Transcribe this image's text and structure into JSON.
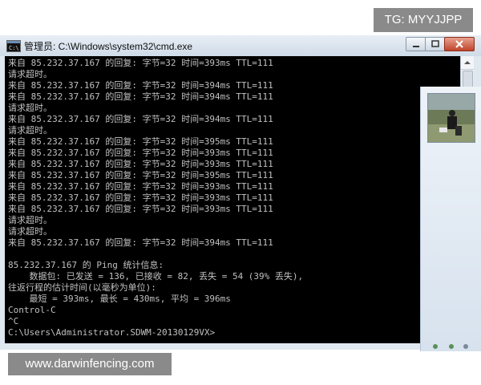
{
  "overlay": {
    "tg_label": "TG: MYYJJPP",
    "site_label": "www.darwinfencing.com"
  },
  "window": {
    "title": "管理员: C:\\Windows\\system32\\cmd.exe"
  },
  "console": {
    "lines": [
      "来自 85.232.37.167 的回复: 字节=32 时间=393ms TTL=111",
      "请求超时。",
      "来自 85.232.37.167 的回复: 字节=32 时间=394ms TTL=111",
      "来自 85.232.37.167 的回复: 字节=32 时间=394ms TTL=111",
      "请求超时。",
      "来自 85.232.37.167 的回复: 字节=32 时间=394ms TTL=111",
      "请求超时。",
      "来自 85.232.37.167 的回复: 字节=32 时间=395ms TTL=111",
      "来自 85.232.37.167 的回复: 字节=32 时间=393ms TTL=111",
      "来自 85.232.37.167 的回复: 字节=32 时间=393ms TTL=111",
      "来自 85.232.37.167 的回复: 字节=32 时间=395ms TTL=111",
      "来自 85.232.37.167 的回复: 字节=32 时间=393ms TTL=111",
      "来自 85.232.37.167 的回复: 字节=32 时间=393ms TTL=111",
      "来自 85.232.37.167 的回复: 字节=32 时间=393ms TTL=111",
      "请求超时。",
      "请求超时。",
      "来自 85.232.37.167 的回复: 字节=32 时间=394ms TTL=111",
      "",
      "85.232.37.167 的 Ping 统计信息:",
      "    数据包: 已发送 = 136, 已接收 = 82, 丢失 = 54 (39% 丢失),",
      "往返行程的估计时间(以毫秒为单位):",
      "    最短 = 393ms, 最长 = 430ms, 平均 = 396ms",
      "Control-C",
      "^C",
      "C:\\Users\\Administrator.SDWM-20130129VX>"
    ]
  },
  "icons": {
    "app": "cmd-icon",
    "minimize": "minimize-icon",
    "maximize": "maximize-icon",
    "close": "close-icon",
    "scroll_up": "scroll-up-arrow-icon"
  },
  "colors": {
    "console_bg": "#000000",
    "console_text": "#c0c0c0"
  }
}
